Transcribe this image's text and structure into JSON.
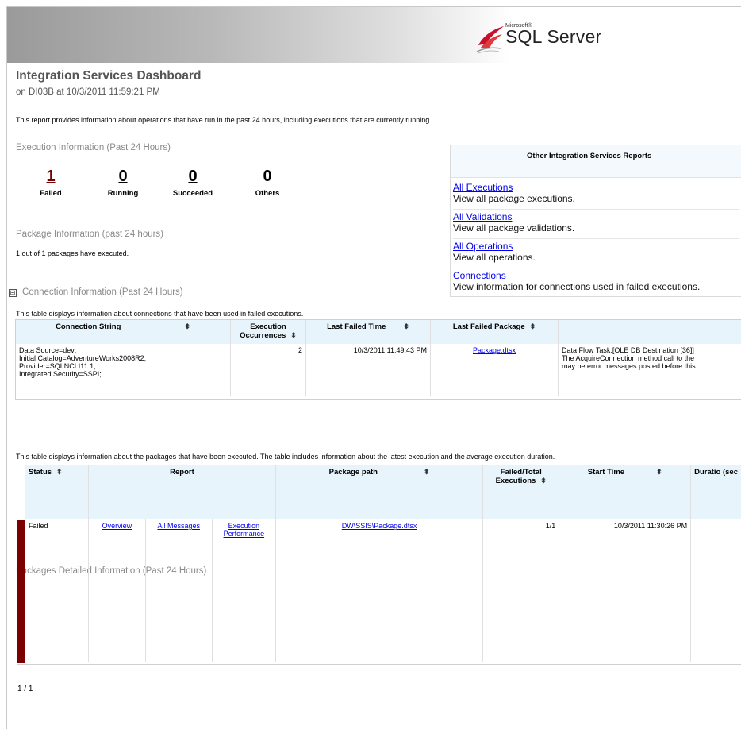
{
  "brand": {
    "ms": "Microsoft®",
    "name": "SQL Server"
  },
  "header": {
    "title": "Integration Services Dashboard",
    "subtitle": "on DI03B at 10/3/2011 11:59:21 PM",
    "description": "This report provides information about operations that have run in the past 24 hours, including executions that are currently running."
  },
  "execution": {
    "heading": "Execution Information (Past 24 Hours)",
    "stats": [
      {
        "value": "1",
        "label": "Failed",
        "color": "#7b0000"
      },
      {
        "value": "0",
        "label": "Running"
      },
      {
        "value": "0",
        "label": "Succeeded"
      },
      {
        "value": "0",
        "label": "Others"
      }
    ]
  },
  "package_info": {
    "heading": "Package Information (past 24 hours)",
    "text": "1 out of 1 packages have executed."
  },
  "other_reports": {
    "title": "Other Integration Services Reports",
    "items": [
      {
        "link": "All Executions",
        "desc": "View all package executions."
      },
      {
        "link": "All Validations",
        "desc": "View all package validations."
      },
      {
        "link": "All Operations",
        "desc": "View all operations."
      },
      {
        "link": "Connections",
        "desc": "View information for connections used in failed executions."
      }
    ]
  },
  "connection": {
    "toggle": "⊟",
    "heading": "Connection Information (Past 24 Hours)",
    "description": "This table displays information about connections that have been used in failed executions.",
    "columns": [
      "Connection String",
      "Execution Occurrences",
      "Last Failed Time",
      "Last Failed Package",
      ""
    ],
    "row": {
      "connection_string": [
        "Data Source=dev;",
        "Initial Catalog=AdventureWorks2008R2;",
        "Provider=SQLNCLI11.1;",
        "Integrated Security=SSPI;"
      ],
      "occurrences": "2",
      "last_failed_time": "10/3/2011 11:49:43 PM",
      "last_failed_package": "Package.dtsx",
      "message": [
        "Data Flow Task:[OLE DB Destination [36]]",
        "The AcquireConnection method call to the",
        "may be error messages posted before this"
      ]
    }
  },
  "packages": {
    "heading": "Packages Detailed Information (Past 24 Hours)",
    "description": "This table displays information about the packages that have been executed. The table includes information about the latest execution and the average execution duration.",
    "columns": [
      "Status",
      "Report",
      "Package path",
      "Failed/Total Executions",
      "Start Time",
      "Duratio (sec"
    ],
    "row": {
      "status": "Failed",
      "overview": "Overview",
      "all_messages": "All Messages",
      "execution_performance": "Execution Performance",
      "package_path": "DW\\SSIS\\Package.dtsx",
      "failed_total": "1/1",
      "start_time": "10/3/2011 11:30:26 PM"
    }
  },
  "pager": {
    "text": "1 / 1"
  },
  "sort_glyph": "⬍"
}
